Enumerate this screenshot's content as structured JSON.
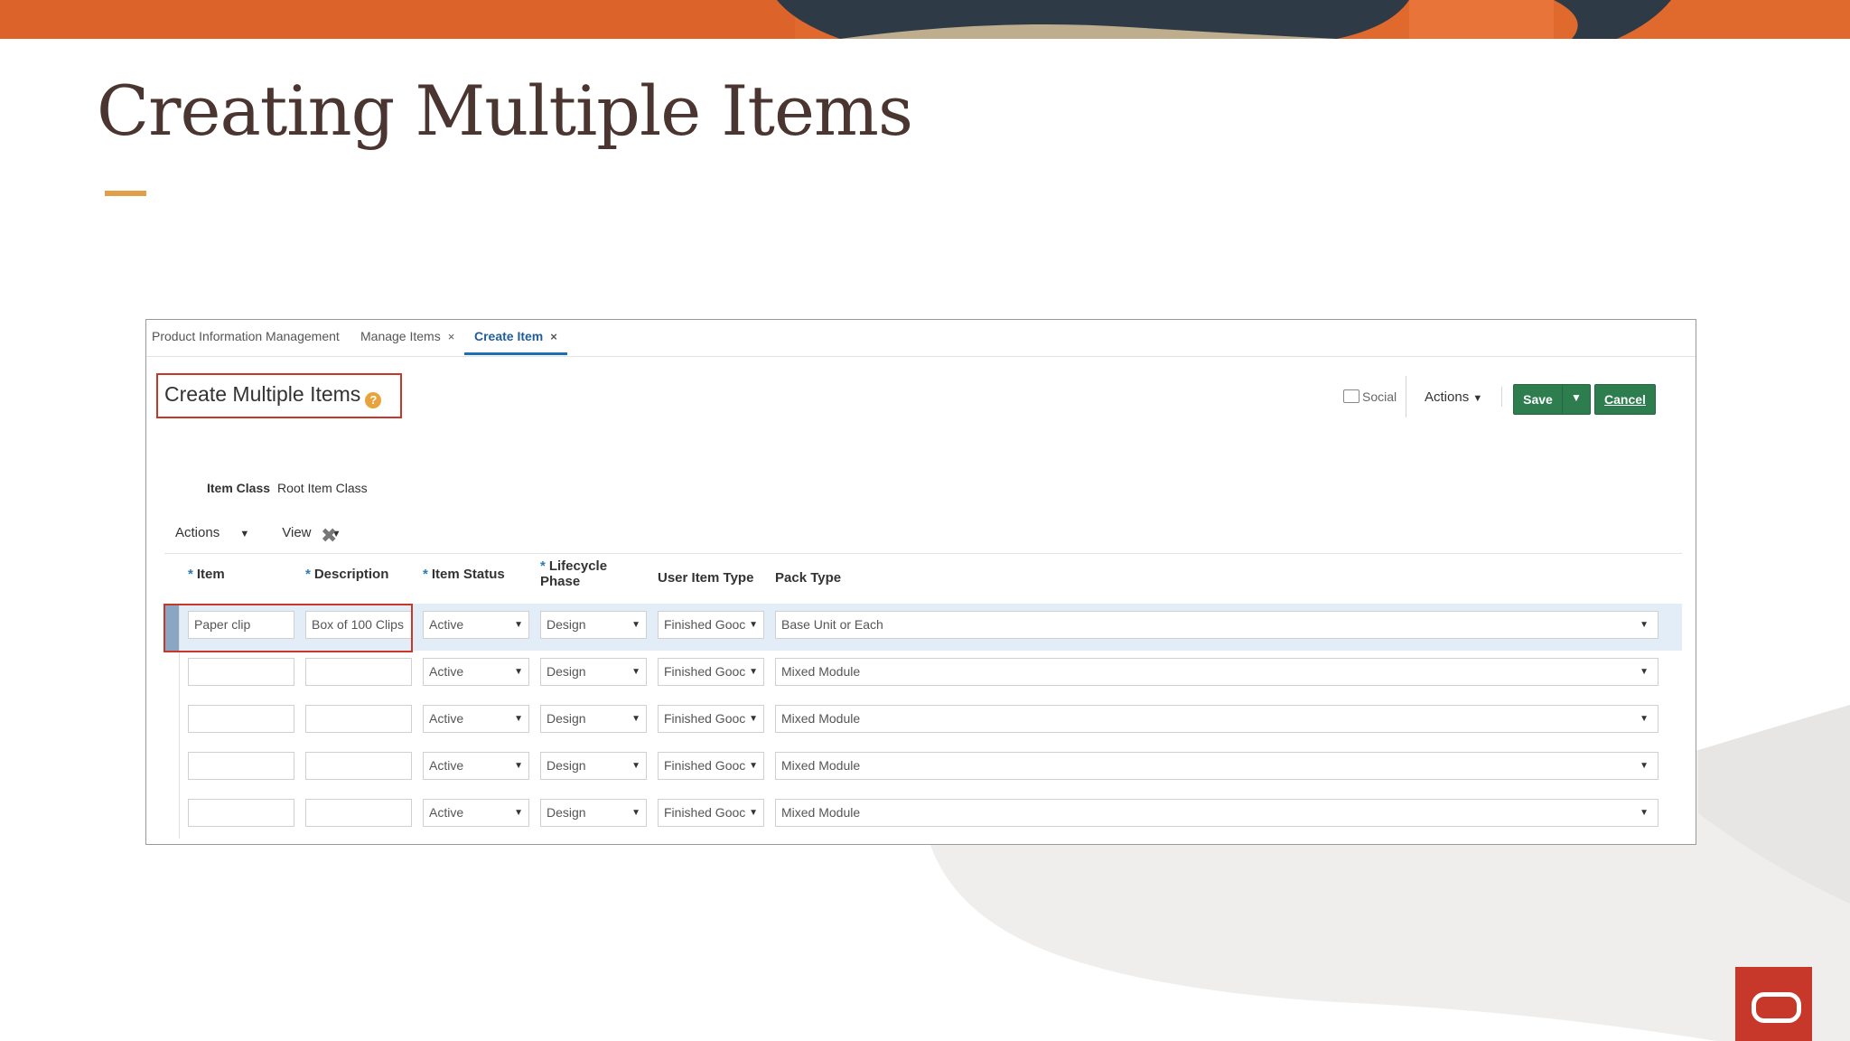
{
  "slide": {
    "title": "Creating Multiple Items"
  },
  "colors": {
    "title": "#4a3530",
    "accent_bar": "#e0a04a",
    "banner_orange": "#e06a2e",
    "banner_dark": "#2f3a47",
    "save_button": "#2e7d4f",
    "highlight_box": "#c7372a",
    "tab_active": "#1f5e9a",
    "oracle_red": "#c7372a"
  },
  "app": {
    "tabs": [
      {
        "label": "Product Information Management",
        "closable": false,
        "active": false
      },
      {
        "label": "Manage Items",
        "close_glyph": "×",
        "active": false
      },
      {
        "label": "Create Item",
        "close_glyph": "×",
        "active": true
      }
    ],
    "page_title": "Create Multiple Items",
    "help_glyph": "?",
    "toolbar": {
      "social_label": "Social",
      "actions_label": "Actions",
      "save_label": "Save",
      "cancel_label": "Cancel"
    },
    "item_class": {
      "label": "Item Class",
      "value": "Root Item Class"
    },
    "table_toolbar": {
      "actions_label": "Actions",
      "view_label": "View"
    },
    "columns": [
      {
        "label": "Item",
        "required": true
      },
      {
        "label": "Description",
        "required": true
      },
      {
        "label": "Item Status",
        "required": true
      },
      {
        "label": "Lifecycle Phase",
        "required": true
      },
      {
        "label": "User Item Type",
        "required": false
      },
      {
        "label": "Pack Type",
        "required": false
      }
    ],
    "rows": [
      {
        "item": "Paper clip",
        "description": "Box of 100 Clips",
        "status": "Active",
        "phase": "Design",
        "user_type": "Finished Gooc",
        "pack_type": "Base Unit or Each",
        "selected": true
      },
      {
        "item": "",
        "description": "",
        "status": "Active",
        "phase": "Design",
        "user_type": "Finished Gooc",
        "pack_type": "Mixed Module",
        "selected": false
      },
      {
        "item": "",
        "description": "",
        "status": "Active",
        "phase": "Design",
        "user_type": "Finished Gooc",
        "pack_type": "Mixed Module",
        "selected": false
      },
      {
        "item": "",
        "description": "",
        "status": "Active",
        "phase": "Design",
        "user_type": "Finished Gooc",
        "pack_type": "Mixed Module",
        "selected": false
      },
      {
        "item": "",
        "description": "",
        "status": "Active",
        "phase": "Design",
        "user_type": "Finished Gooc",
        "pack_type": "Mixed Module",
        "selected": false
      }
    ]
  }
}
